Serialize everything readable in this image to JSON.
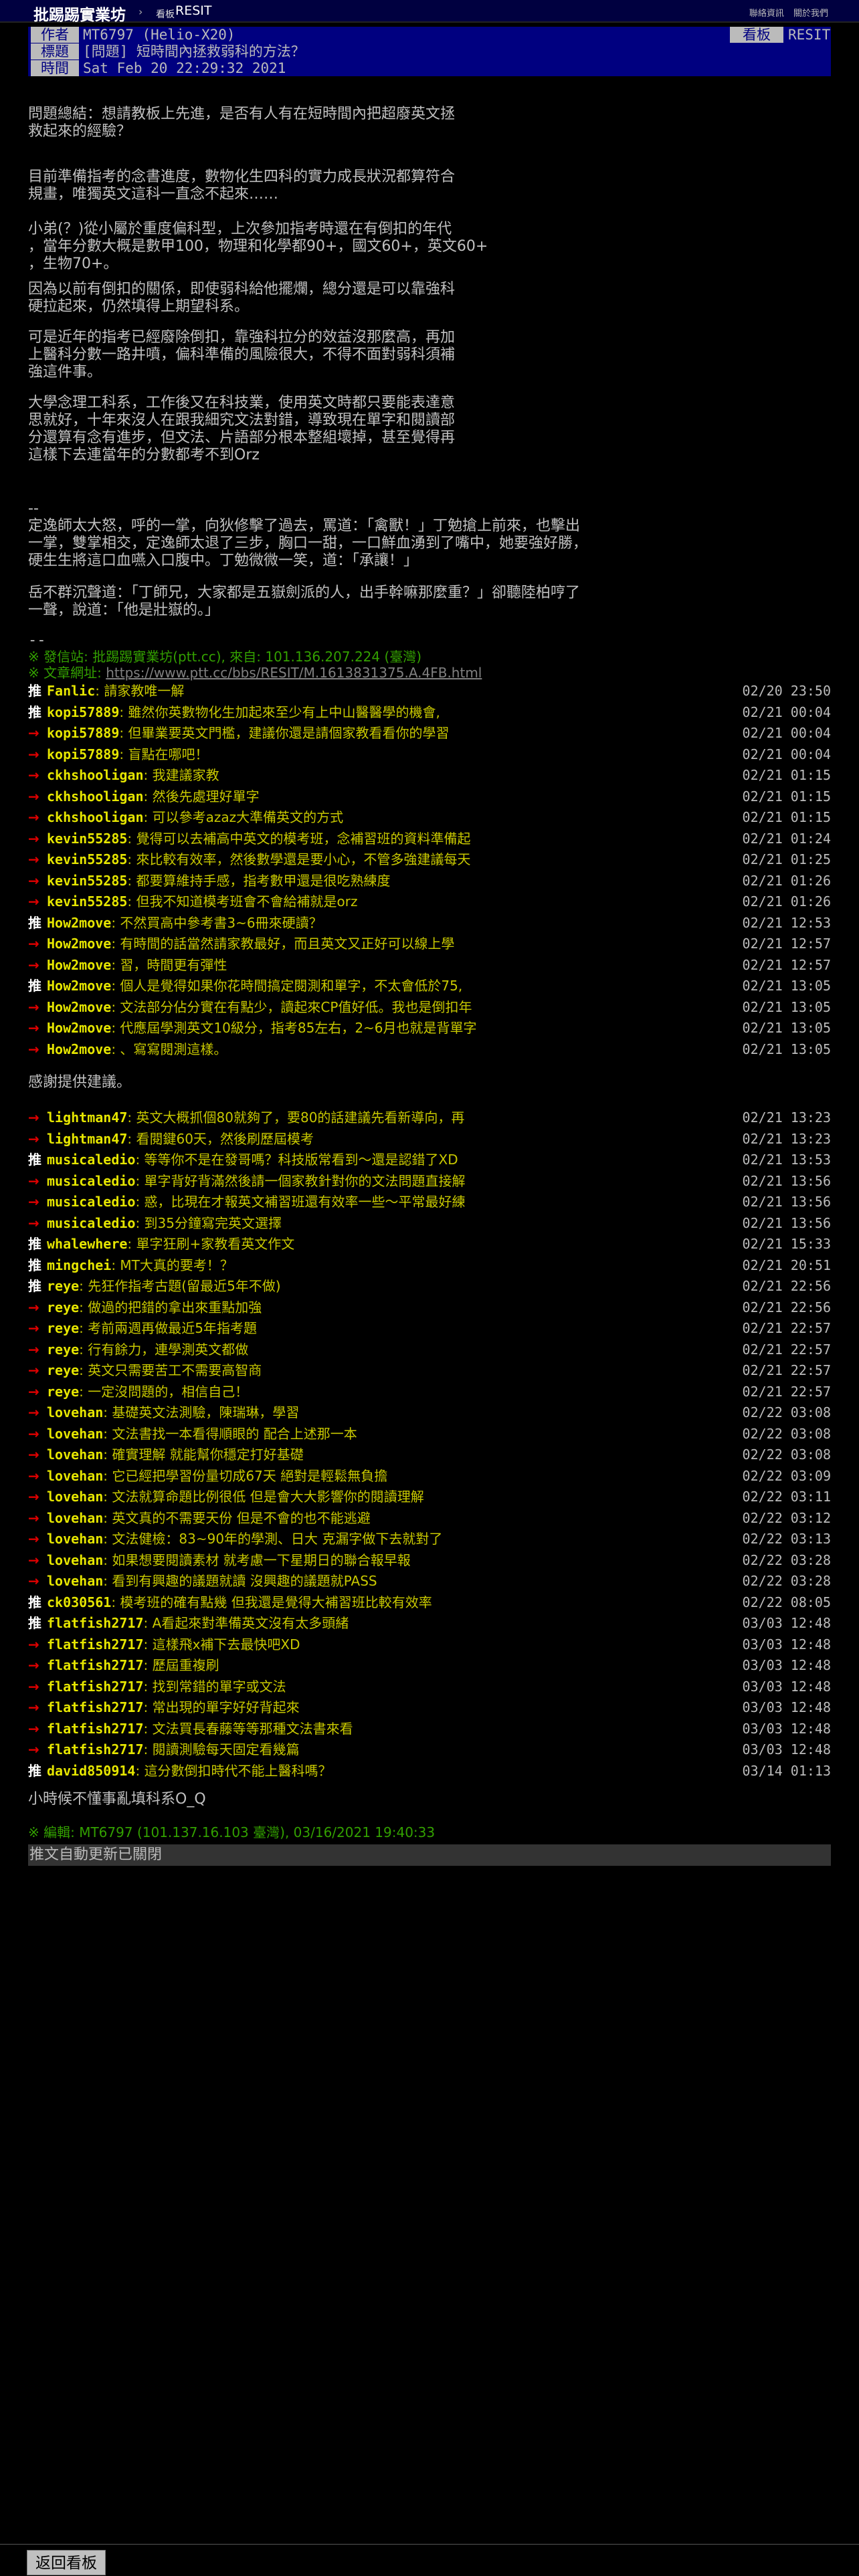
{
  "topbar": {
    "brand": "批踢踢實業坊",
    "separator": "›",
    "board_tag": "看板",
    "board_name": "RESIT",
    "links": [
      "聯絡資訊",
      "關於我們"
    ]
  },
  "meta": {
    "author_label": "作者",
    "author": "MT6797 (Helio-X20)",
    "board_label": "看板",
    "board": "RESIT",
    "title_label": "標題",
    "title": "[問題] 短時間內拯救弱科的方法？",
    "time_label": "時間",
    "time": "Sat Feb 20 22:29:32 2021"
  },
  "body": [
    "問題總結：想請教板上先進，是否有人有在短時間內把超廢英文拯\n救起來的經驗？",
    "目前準備指考的念書進度，數物化生四科的實力成長狀況都算符合\n規畫，唯獨英文這科一直念不起來……",
    "小弟(？)從小屬於重度偏科型，上次參加指考時還在有倒扣的年代\n，當年分數大概是數甲100，物理和化學都90+，國文60+，英文60+\n，生物70+。",
    "因為以前有倒扣的關係，即使弱科給他擺爛，總分還是可以靠強科\n硬拉起來，仍然填得上期望科系。",
    "可是近年的指考已經廢除倒扣，靠強科拉分的效益沒那麼高，再加\n上醫科分數一路井噴，偏科準備的風險很大，不得不面對弱科須補\n強這件事。",
    "大學念理工科系，工作後又在科技業，使用英文時都只要能表達意\n思就好，十年來沒人在跟我細究文法對錯，導致現在單字和閱讀部\n分還算有念有進步，但文法、片語部分根本整組壞掉，甚至覺得再\n這樣下去連當年的分數都考不到Orz",
    "--\n定逸師太大怒，呼的一掌，向狄修擊了過去，罵道：「禽獸！」丁勉搶上前來，也擊出\n一掌，雙掌相交，定逸師太退了三步，胸口一甜，一口鮮血湧到了嘴中，她要強好勝，\n硬生生將這口血嚥入口腹中。丁勉微微一笑，道：「承讓！」",
    "岳不群沉聲道：「丁師兄，大家都是五嶽劍派的人，出手幹嘛那麼重？」卻聽陸柏哼了\n一聲，說道：「他是壯嶽的。」"
  ],
  "signature": {
    "sep": "--",
    "site_line": "※ 發信站: 批踢踢實業坊(ptt.cc), 來自: 101.136.207.224 (臺灣)",
    "url_label": "※ 文章網址: ",
    "url": "https://www.ptt.cc/bbs/RESIT/M.1613831375.A.4FB.html"
  },
  "pushes_a": [
    {
      "tag": "推",
      "id": "Fanlic",
      "text": ": 請家教唯一解",
      "time": "02/20 23:50"
    },
    {
      "tag": "推",
      "id": "kopi57889",
      "text": ": 雖然你英數物化生加起來至少有上中山醫醫學的機會,",
      "time": "02/21 00:04"
    },
    {
      "tag": "→",
      "id": "kopi57889",
      "text": ": 但畢業要英文門檻，建議你還是請個家教看看你的學習",
      "time": "02/21 00:04"
    },
    {
      "tag": "→",
      "id": "kopi57889",
      "text": ": 盲點在哪吧！",
      "time": "02/21 00:04"
    },
    {
      "tag": "→",
      "id": "ckhshooligan",
      "text": ": 我建議家教",
      "time": "02/21 01:15"
    },
    {
      "tag": "→",
      "id": "ckhshooligan",
      "text": ": 然後先處理好單字",
      "time": "02/21 01:15"
    },
    {
      "tag": "→",
      "id": "ckhshooligan",
      "text": ": 可以參考azaz大準備英文的方式",
      "time": "02/21 01:15"
    },
    {
      "tag": "→",
      "id": "kevin55285",
      "text": ": 覺得可以去補高中英文的模考班，念補習班的資料準備起",
      "time": "02/21 01:24"
    },
    {
      "tag": "→",
      "id": "kevin55285",
      "text": ": 來比較有效率，然後數學還是要小心，不管多強建議每天",
      "time": "02/21 01:25"
    },
    {
      "tag": "→",
      "id": "kevin55285",
      "text": ": 都要算維持手感，指考數甲還是很吃熟練度",
      "time": "02/21 01:26"
    },
    {
      "tag": "→",
      "id": "kevin55285",
      "text": ": 但我不知道模考班會不會給補就是orz",
      "time": "02/21 01:26"
    },
    {
      "tag": "推",
      "id": "How2move",
      "text": ": 不然買高中參考書3~6冊來硬讀？",
      "time": "02/21 12:53"
    },
    {
      "tag": "→",
      "id": "How2move",
      "text": ": 有時間的話當然請家教最好，而且英文又正好可以線上學",
      "time": "02/21 12:57"
    },
    {
      "tag": "→",
      "id": "How2move",
      "text": ": 習，時間更有彈性",
      "time": "02/21 12:57"
    },
    {
      "tag": "推",
      "id": "How2move",
      "text": ": 個人是覺得如果你花時間搞定閱測和單字，不太會低於75,",
      "time": "02/21 13:05"
    },
    {
      "tag": "→",
      "id": "How2move",
      "text": ": 文法部分佔分實在有點少，讀起來CP值好低。我也是倒扣年",
      "time": "02/21 13:05"
    },
    {
      "tag": "→",
      "id": "How2move",
      "text": ": 代應屆學測英文10級分，指考85左右，2~6月也就是背單字",
      "time": "02/21 13:05"
    },
    {
      "tag": "→",
      "id": "How2move",
      "text": ": 、寫寫閱測這樣。",
      "time": "02/21 13:05"
    }
  ],
  "mid_text": "感謝提供建議。",
  "pushes_b": [
    {
      "tag": "→",
      "id": "lightman47",
      "text": ": 英文大概抓個80就夠了，要80的話建議先看新導向，再",
      "time": "02/21 13:23"
    },
    {
      "tag": "→",
      "id": "lightman47",
      "text": ": 看閱鍵60天，然後刷歷屆模考",
      "time": "02/21 13:23"
    },
    {
      "tag": "推",
      "id": "musicaledio",
      "text": ": 等等你不是在發哥嗎？科技版常看到～還是認錯了XD",
      "time": "02/21 13:53"
    },
    {
      "tag": "→",
      "id": "musicaledio",
      "text": ": 單字背好背滿然後請一個家教針對你的文法問題直接解",
      "time": "02/21 13:56"
    },
    {
      "tag": "→",
      "id": "musicaledio",
      "text": ": 惑，比現在才報英文補習班還有效率一些～平常最好練",
      "time": "02/21 13:56"
    },
    {
      "tag": "→",
      "id": "musicaledio",
      "text": ": 到35分鐘寫完英文選擇",
      "time": "02/21 13:56"
    },
    {
      "tag": "推",
      "id": "whalewhere",
      "text": ": 單字狂刷+家教看英文作文",
      "time": "02/21 15:33"
    },
    {
      "tag": "推",
      "id": "mingchei",
      "text": ": MT大真的要考！？",
      "time": "02/21 20:51"
    },
    {
      "tag": "推",
      "id": "reye",
      "text": ": 先狂作指考古題(留最近5年不做)",
      "time": "02/21 22:56"
    },
    {
      "tag": "→",
      "id": "reye",
      "text": ": 做過的把錯的拿出來重點加強",
      "time": "02/21 22:56"
    },
    {
      "tag": "→",
      "id": "reye",
      "text": ": 考前兩週再做最近5年指考題",
      "time": "02/21 22:57"
    },
    {
      "tag": "→",
      "id": "reye",
      "text": ": 行有餘力，連學測英文都做",
      "time": "02/21 22:57"
    },
    {
      "tag": "→",
      "id": "reye",
      "text": ": 英文只需要苦工不需要高智商",
      "time": "02/21 22:57"
    },
    {
      "tag": "→",
      "id": "reye",
      "text": ": 一定沒問題的，相信自己！",
      "time": "02/21 22:57"
    },
    {
      "tag": "→",
      "id": "lovehan",
      "text": ": 基礎英文法測驗，陳瑞琳，學習",
      "time": "02/22 03:08"
    },
    {
      "tag": "→",
      "id": "lovehan",
      "text": ": 文法書找一本看得順眼的   配合上述那一本",
      "time": "02/22 03:08"
    },
    {
      "tag": "→",
      "id": "lovehan",
      "text": ": 確實理解   就能幫你穩定打好基礎",
      "time": "02/22 03:08"
    },
    {
      "tag": "→",
      "id": "lovehan",
      "text": ": 它已經把學習份量切成67天   絕對是輕鬆無負擔",
      "time": "02/22 03:09"
    },
    {
      "tag": "→",
      "id": "lovehan",
      "text": ": 文法就算命題比例很低   但是會大大影響你的閱讀理解",
      "time": "02/22 03:11"
    },
    {
      "tag": "→",
      "id": "lovehan",
      "text": ": 英文真的不需要天份   但是不會的也不能逃避",
      "time": "02/22 03:12"
    },
    {
      "tag": "→",
      "id": "lovehan",
      "text": ": 文法健檢：83~90年的學測、日大   克漏字做下去就對了",
      "time": "02/22 03:13"
    },
    {
      "tag": "→",
      "id": "lovehan",
      "text": ": 如果想要閱讀素材   就考慮一下星期日的聯合報早報",
      "time": "02/22 03:28"
    },
    {
      "tag": "→",
      "id": "lovehan",
      "text": ": 看到有興趣的議題就讀   沒興趣的議題就PASS",
      "time": "02/22 03:28"
    },
    {
      "tag": "推",
      "id": "ck030561",
      "text": ": 模考班的確有點幾 但我還是覺得大補習班比較有效率",
      "time": "02/22 08:05"
    },
    {
      "tag": "推",
      "id": "flatfish2717",
      "text": ": A看起來對準備英文沒有太多頭緒",
      "time": "03/03 12:48"
    },
    {
      "tag": "→",
      "id": "flatfish2717",
      "text": ": 這樣飛x補下去最快吧XD",
      "time": "03/03 12:48"
    },
    {
      "tag": "→",
      "id": "flatfish2717",
      "text": ": 歷屆重複刷",
      "time": "03/03 12:48"
    },
    {
      "tag": "→",
      "id": "flatfish2717",
      "text": ": 找到常錯的單字或文法",
      "time": "03/03 12:48"
    },
    {
      "tag": "→",
      "id": "flatfish2717",
      "text": ": 常出現的單字好好背起來",
      "time": "03/03 12:48"
    },
    {
      "tag": "→",
      "id": "flatfish2717",
      "text": ": 文法買長春藤等等那種文法書來看",
      "time": "03/03 12:48"
    },
    {
      "tag": "→",
      "id": "flatfish2717",
      "text": ": 閱讀測驗每天固定看幾篇",
      "time": "03/03 12:48"
    },
    {
      "tag": "推",
      "id": "david850914",
      "text": ": 這分數倒扣時代不能上醫科嗎？",
      "time": "03/14 01:13"
    }
  ],
  "end_text": "小時候不懂事亂填科系O_Q",
  "edit_line": "※ 編輯: MT6797 (101.137.16.103 臺灣), 03/16/2021 19:40:33",
  "notice": "推文自動更新已關閉",
  "bottom": {
    "back_label": "返回看板"
  },
  "colors": {
    "push_up": "#ffffff",
    "push_arrow": "#e00000",
    "userid": "#e6e600",
    "push_text": "#c8c800",
    "meta_bg": "#000080",
    "green": "#33a000"
  }
}
